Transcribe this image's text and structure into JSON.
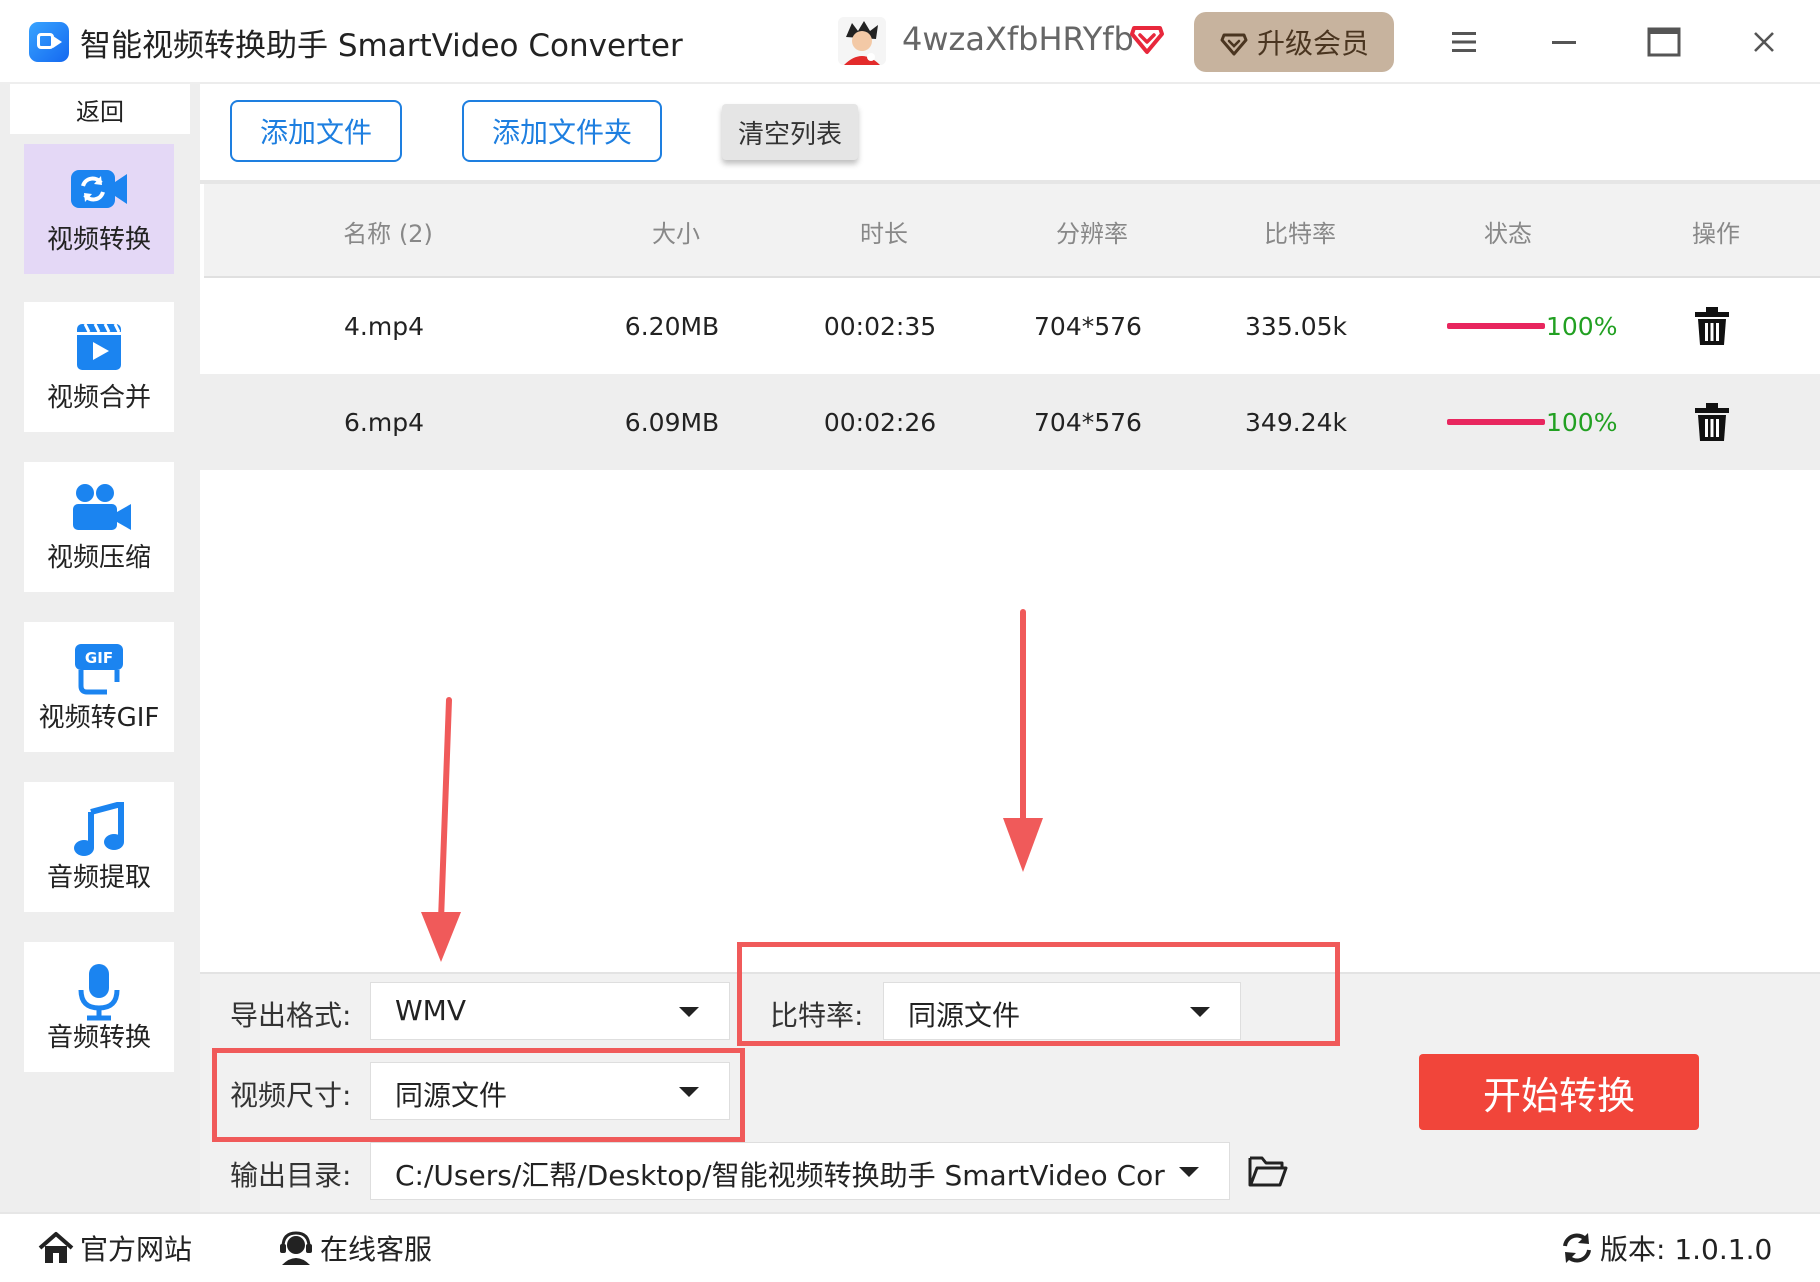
{
  "window": {
    "title": "智能视频转换助手 SmartVideo Converter",
    "username": "4wzaXfbHRYfb",
    "upgrade_label": "升级会员"
  },
  "sidebar": {
    "back_label": "返回",
    "items": [
      {
        "label": "视频转换",
        "icon": "video-convert-icon",
        "active": true
      },
      {
        "label": "视频合并",
        "icon": "video-merge-icon",
        "active": false
      },
      {
        "label": "视频压缩",
        "icon": "video-compress-icon",
        "active": false
      },
      {
        "label": "视频转GIF",
        "icon": "gif-icon",
        "active": false
      },
      {
        "label": "音频提取",
        "icon": "music-note-icon",
        "active": false
      },
      {
        "label": "音频转换",
        "icon": "microphone-icon",
        "active": false
      }
    ]
  },
  "toolbar": {
    "add_file": "添加文件",
    "add_folder": "添加文件夹",
    "clear_list": "清空列表"
  },
  "table": {
    "columns": [
      "名称 (2)",
      "大小",
      "时长",
      "分辨率",
      "比特率",
      "状态",
      "操作"
    ],
    "rows": [
      {
        "name": "4.mp4",
        "size": "6.20MB",
        "duration": "00:02:35",
        "resolution": "704*576",
        "bitrate": "335.05k",
        "progress": 1.0,
        "status": "100%"
      },
      {
        "name": "6.mp4",
        "size": "6.09MB",
        "duration": "00:02:26",
        "resolution": "704*576",
        "bitrate": "349.24k",
        "progress": 1.0,
        "status": "100%"
      }
    ]
  },
  "settings": {
    "format_label": "导出格式:",
    "format_value": "WMV",
    "bitrate_label": "比特率:",
    "bitrate_value": "同源文件",
    "size_label": "视频尺寸:",
    "size_value": "同源文件",
    "output_label": "输出目录:",
    "output_value": "C:/Users/汇帮/Desktop/智能视频转换助手 SmartVideo Cor",
    "start_label": "开始转换"
  },
  "footer": {
    "website": "官方网站",
    "service": "在线客服",
    "version": "版本:  1.0.1.0"
  },
  "colors": {
    "accent_blue": "#1e7fe0",
    "start_red": "#f1453a",
    "progress_pink": "#e8265e",
    "status_green": "#22a022",
    "annotation_red": "#f05a5a",
    "upgrade_tan": "#c7b39e"
  }
}
